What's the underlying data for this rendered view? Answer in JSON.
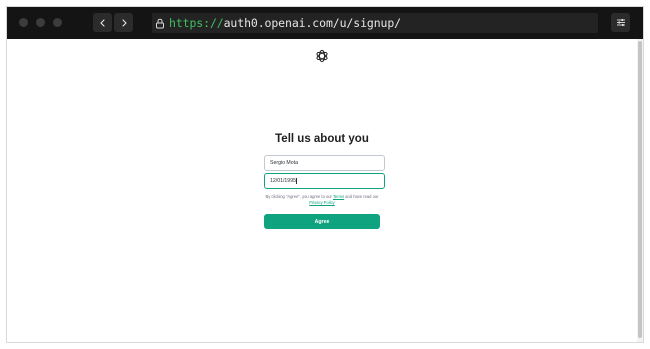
{
  "browser": {
    "address_bar": {
      "scheme": "https://",
      "rest": "auth0.openai.com/u/signup/"
    },
    "icons": {
      "back": "chevron-left-icon",
      "forward": "chevron-right-icon",
      "lock": "lock-icon",
      "menu": "sliders-icon"
    }
  },
  "page": {
    "logo": "openai-logo",
    "heading": "Tell us about you",
    "fields": {
      "name_value": "Sergio Mota",
      "birthday_value": "12/01/1995"
    },
    "legal": {
      "text_before_terms": "By clicking \"Agree\", you agree to our ",
      "terms_link": "Terms",
      "text_between": " and have read our ",
      "privacy_link": "Privacy Policy",
      "text_after": ""
    },
    "agree_button": "Agree"
  },
  "colors": {
    "accent": "#10a37f",
    "titlebar": "#141414",
    "url_scheme": "#3fbf60"
  }
}
